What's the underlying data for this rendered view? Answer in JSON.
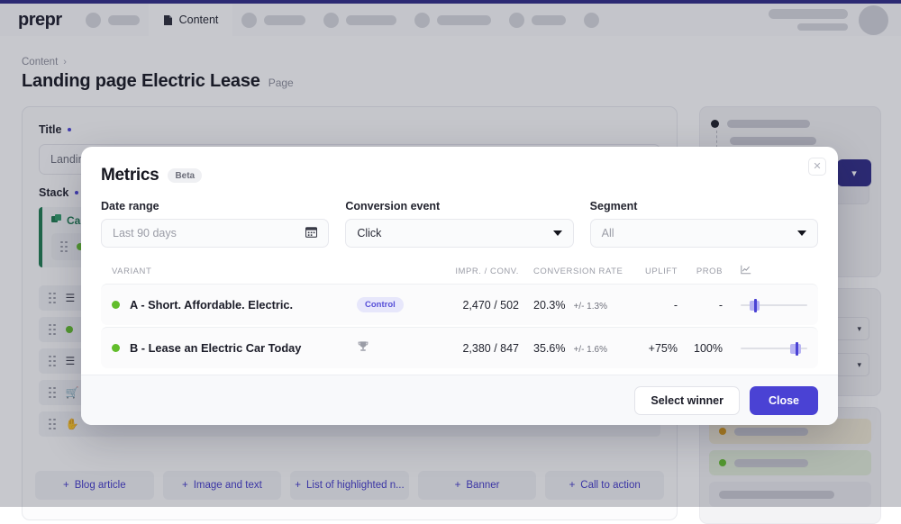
{
  "topbar": {
    "brand": "prepr",
    "active_tab": {
      "label": "Content",
      "icon": "document-icon"
    }
  },
  "breadcrumb": {
    "parent": "Content",
    "separator": "›"
  },
  "header": {
    "title": "Landing page Electric Lease",
    "subtype": "Page"
  },
  "editor": {
    "title_field": {
      "label": "Title",
      "value": "Landing"
    },
    "stack_field": {
      "label": "Stack",
      "block_label": "Cal"
    },
    "add_buttons": [
      {
        "label": "Blog article"
      },
      {
        "label": "Image and text"
      },
      {
        "label": "List of highlighted n..."
      },
      {
        "label": "Banner"
      },
      {
        "label": "Call to action"
      }
    ]
  },
  "modal": {
    "title": "Metrics",
    "badge": "Beta",
    "close_icon": "close-icon",
    "filters": {
      "date_range": {
        "label": "Date range",
        "placeholder": "Last 90 days",
        "icon": "calendar-icon"
      },
      "conversion_event": {
        "label": "Conversion event",
        "value": "Click",
        "icon": "chevron-down-icon"
      },
      "segment": {
        "label": "Segment",
        "placeholder": "All",
        "icon": "chevron-down-icon"
      }
    },
    "table": {
      "columns": [
        "VARIANT",
        "",
        "IMPR. / CONV.",
        "CONVERSION RATE",
        "UPLIFT",
        "PROB",
        "chart-icon"
      ],
      "rows": [
        {
          "status": "active",
          "name": "A - Short. Affordable. Electric.",
          "badge": "Control",
          "badge_type": "control",
          "impressions_conversions": "2,470 / 502",
          "conversion_rate": "20.3%",
          "conversion_ci": "+/- 1.3%",
          "uplift": "-",
          "prob": "-",
          "ci_center_pct": 20.3,
          "ci_band_lo_pct": 13,
          "ci_band_hi_pct": 28
        },
        {
          "status": "active",
          "name": "B - Lease an Electric Car Today",
          "badge": "",
          "badge_type": "winner",
          "badge_icon": "trophy-icon",
          "impressions_conversions": "2,380 / 847",
          "conversion_rate": "35.6%",
          "conversion_ci": "+/- 1.6%",
          "uplift": "+75%",
          "prob": "100%",
          "ci_center_pct": 82,
          "ci_band_lo_pct": 74,
          "ci_band_hi_pct": 90
        }
      ]
    },
    "footer": {
      "select_winner_label": "Select winner",
      "close_label": "Close"
    }
  },
  "chart_data": {
    "type": "bar",
    "title": "Metrics — A/B test conversion results",
    "categories": [
      "A - Short. Affordable. Electric.",
      "B - Lease an Electric Car Today"
    ],
    "series": [
      {
        "name": "Impressions",
        "values": [
          2470,
          2380
        ]
      },
      {
        "name": "Conversions",
        "values": [
          502,
          847
        ]
      },
      {
        "name": "Conversion rate (%)",
        "values": [
          20.3,
          35.6
        ]
      },
      {
        "name": "Conversion rate CI (+/- %)",
        "values": [
          1.3,
          1.6
        ]
      },
      {
        "name": "Uplift (%)",
        "values": [
          null,
          75
        ]
      },
      {
        "name": "Probability to win (%)",
        "values": [
          null,
          100
        ]
      }
    ],
    "xlabel": "Variant",
    "ylabel": "Conversion rate",
    "ylim": [
      0,
      40
    ],
    "grid": false,
    "legend": "none",
    "annotations": [
      "Control = Variant A",
      "Winner = Variant B"
    ]
  },
  "colors": {
    "brand_indigo": "#2e2b86",
    "accent_indigo": "#4a42d4",
    "status_green": "#62bd2b",
    "badge_lavender": "#e7e7fb",
    "ci_band": "#b8b4f3"
  }
}
